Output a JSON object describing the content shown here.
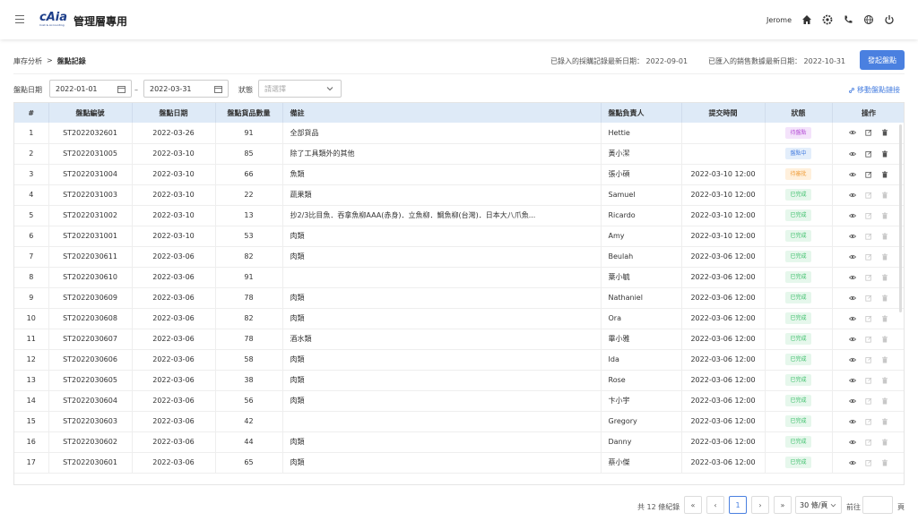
{
  "header": {
    "logo_text": "cAia",
    "logo_sub": "Cost & Accounting",
    "title": "管理層專用",
    "user": "Jerome"
  },
  "breadcrumb": {
    "parent": "庫存分析",
    "separator": ">",
    "current": "盤點記錄"
  },
  "info": {
    "purchase_label": "已錄入的採購記錄最新日期：",
    "purchase_date": "2022-09-01",
    "sales_label": "已匯入的銷售數據最新日期：",
    "sales_date": "2022-10-31"
  },
  "actions": {
    "start_count": "發起盤點",
    "move_link": "移動盤點鏈接"
  },
  "filters": {
    "date_label": "盤點日期",
    "date_from": "2022-01-01",
    "date_to": "2022-03-31",
    "status_label": "狀態",
    "status_placeholder": "請選擇",
    "dash": "–"
  },
  "table": {
    "columns": [
      "#",
      "盤點編號",
      "盤點日期",
      "盤點貨品數量",
      "備註",
      "盤點負責人",
      "提交時間",
      "狀態",
      "操作"
    ],
    "rows": [
      {
        "n": "1",
        "id": "ST2022032601",
        "date": "2022-03-26",
        "qty": "91",
        "note": "全部貨品",
        "owner": "Hettie",
        "submitted": "",
        "status": "待盤點",
        "status_color": "purple"
      },
      {
        "n": "2",
        "id": "ST2022031005",
        "date": "2022-03-10",
        "qty": "85",
        "note": "除了工具類外的其他",
        "owner": "黃小潔",
        "submitted": "",
        "status": "盤點中",
        "status_color": "blue"
      },
      {
        "n": "3",
        "id": "ST2022031004",
        "date": "2022-03-10",
        "qty": "66",
        "note": "魚類",
        "owner": "張小碩",
        "submitted": "2022-03-10 12:00",
        "status": "待審批",
        "status_color": "orange"
      },
      {
        "n": "4",
        "id": "ST2022031003",
        "date": "2022-03-10",
        "qty": "22",
        "note": "蔬果類",
        "owner": "Samuel",
        "submitted": "2022-03-10 12:00",
        "status": "已完成",
        "status_color": "green"
      },
      {
        "n": "5",
        "id": "ST2022031002",
        "date": "2022-03-10",
        "qty": "13",
        "note": "抄2/3比目魚．吞拿魚柳AAA(赤身)．立魚柳．鯛魚柳(台灣)．日本大八爪魚...",
        "owner": "Ricardo",
        "submitted": "2022-03-10 12:00",
        "status": "已完成",
        "status_color": "green"
      },
      {
        "n": "6",
        "id": "ST2022031001",
        "date": "2022-03-10",
        "qty": "53",
        "note": "肉類",
        "owner": "Amy",
        "submitted": "2022-03-10 12:00",
        "status": "已完成",
        "status_color": "green"
      },
      {
        "n": "7",
        "id": "ST2022030611",
        "date": "2022-03-06",
        "qty": "82",
        "note": "肉類",
        "owner": "Beulah",
        "submitted": "2022-03-06 12:00",
        "status": "已完成",
        "status_color": "green"
      },
      {
        "n": "8",
        "id": "ST2022030610",
        "date": "2022-03-06",
        "qty": "91",
        "note": "",
        "owner": "葉小毓",
        "submitted": "2022-03-06 12:00",
        "status": "已完成",
        "status_color": "green"
      },
      {
        "n": "9",
        "id": "ST2022030609",
        "date": "2022-03-06",
        "qty": "78",
        "note": "肉類",
        "owner": "Nathaniel",
        "submitted": "2022-03-06 12:00",
        "status": "已完成",
        "status_color": "green"
      },
      {
        "n": "10",
        "id": "ST2022030608",
        "date": "2022-03-06",
        "qty": "82",
        "note": "肉類",
        "owner": "Ora",
        "submitted": "2022-03-06 12:00",
        "status": "已完成",
        "status_color": "green"
      },
      {
        "n": "11",
        "id": "ST2022030607",
        "date": "2022-03-06",
        "qty": "78",
        "note": "酒水類",
        "owner": "畢小雅",
        "submitted": "2022-03-06 12:00",
        "status": "已完成",
        "status_color": "green"
      },
      {
        "n": "12",
        "id": "ST2022030606",
        "date": "2022-03-06",
        "qty": "58",
        "note": "肉類",
        "owner": "Ida",
        "submitted": "2022-03-06 12:00",
        "status": "已完成",
        "status_color": "green"
      },
      {
        "n": "13",
        "id": "ST2022030605",
        "date": "2022-03-06",
        "qty": "38",
        "note": "肉類",
        "owner": "Rose",
        "submitted": "2022-03-06 12:00",
        "status": "已完成",
        "status_color": "green"
      },
      {
        "n": "14",
        "id": "ST2022030604",
        "date": "2022-03-06",
        "qty": "56",
        "note": "肉類",
        "owner": "卞小宇",
        "submitted": "2022-03-06 12:00",
        "status": "已完成",
        "status_color": "green"
      },
      {
        "n": "15",
        "id": "ST2022030603",
        "date": "2022-03-06",
        "qty": "42",
        "note": "",
        "owner": "Gregory",
        "submitted": "2022-03-06 12:00",
        "status": "已完成",
        "status_color": "green"
      },
      {
        "n": "16",
        "id": "ST2022030602",
        "date": "2022-03-06",
        "qty": "44",
        "note": "肉類",
        "owner": "Danny",
        "submitted": "2022-03-06 12:00",
        "status": "已完成",
        "status_color": "green"
      },
      {
        "n": "17",
        "id": "ST2022030601",
        "date": "2022-03-06",
        "qty": "65",
        "note": "肉類",
        "owner": "蔡小傑",
        "submitted": "2022-03-06 12:00",
        "status": "已完成",
        "status_color": "green"
      }
    ]
  },
  "pagination": {
    "total": "共 12 條紀錄",
    "first": "«",
    "prev": "‹",
    "current": "1",
    "next": "›",
    "last": "»",
    "page_size": "30 條/頁",
    "goto_label": "前往",
    "goto_suffix": "頁"
  },
  "colors": {
    "accent": "#4a80e0",
    "header_bg": "#deeaf7",
    "status": {
      "purple": {
        "bg": "#f4e3fb",
        "fg": "#b54fd6"
      },
      "blue": {
        "bg": "#e3eefb",
        "fg": "#4a80e0"
      },
      "orange": {
        "bg": "#fff0dc",
        "fg": "#f0a040"
      },
      "green": {
        "bg": "#e6f7ec",
        "fg": "#3cbf6a"
      }
    }
  }
}
